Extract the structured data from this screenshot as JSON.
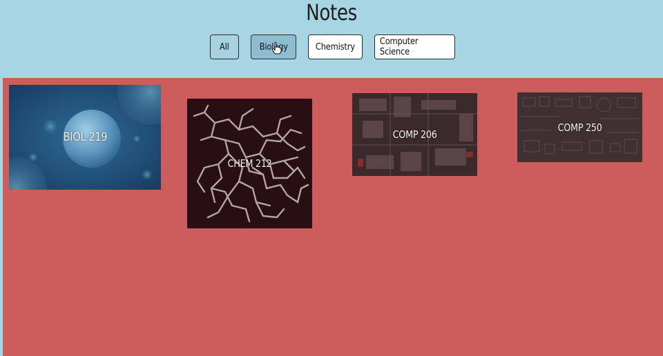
{
  "page": {
    "title": "Notes"
  },
  "filters": [
    {
      "label": "All",
      "active": false
    },
    {
      "label": "Biology",
      "active": true
    },
    {
      "label": "Chemistry",
      "active": false
    },
    {
      "label": "Computer Science",
      "active": false
    }
  ],
  "cards": [
    {
      "label": "BIOL 219",
      "image": "cells-microscope-image"
    },
    {
      "label": "CHEM 212",
      "image": "molecule-structure-image"
    },
    {
      "label": "COMP 206",
      "image": "circuit-board-image"
    },
    {
      "label": "COMP 250",
      "image": "tech-icons-pattern-image"
    }
  ],
  "colors": {
    "header_bg": "#a8d5e4",
    "content_bg": "#cd5c5c",
    "active_filter_bg": "#8dbdd0"
  }
}
